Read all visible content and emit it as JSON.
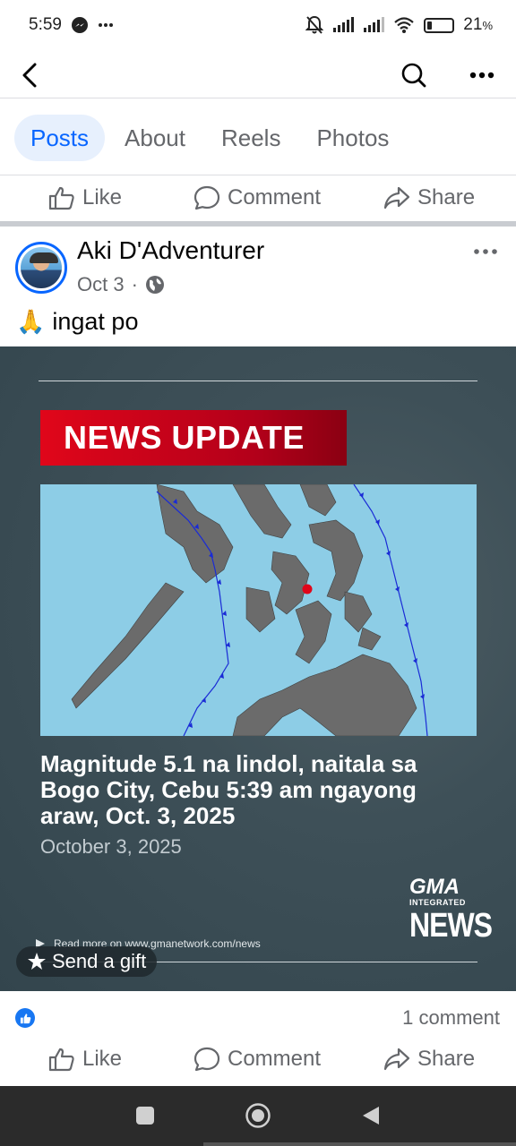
{
  "status_bar": {
    "time": "5:59",
    "battery_pct": "21",
    "battery_unit": "%",
    "battery_level": 0.21
  },
  "top_nav": {
    "back_icon": "back-arrow-icon",
    "search_icon": "search-icon",
    "more_icon": "more-dots-icon"
  },
  "tabs": [
    {
      "label": "Posts",
      "active": true
    },
    {
      "label": "About",
      "active": false
    },
    {
      "label": "Reels",
      "active": false
    },
    {
      "label": "Photos",
      "active": false
    }
  ],
  "top_actions": {
    "like": "Like",
    "comment": "Comment",
    "share": "Share"
  },
  "post": {
    "author": "Aki D'Adventurer",
    "date": "Oct 3",
    "separator": "·",
    "privacy_icon": "globe-icon",
    "text": "ingat po",
    "emoji": "🙏",
    "image": {
      "banner": "NEWS UPDATE",
      "headline": "Magnitude 5.1 na lindol, naitala sa Bogo City, Cebu 5:39 am ngayong araw, Oct. 3, 2025",
      "date": "October 3, 2025",
      "logo_top": "GMA",
      "logo_mid": "INTEGRATED",
      "logo_bottom": "NEWS",
      "read_more": "Read more on www.gmanetwork.com/news"
    },
    "send_gift": "Send a gift",
    "comment_count": "1 comment",
    "actions": {
      "like": "Like",
      "comment": "Comment",
      "share": "Share"
    }
  },
  "colors": {
    "accent": "#0866ff",
    "banner_red": "#e0061a",
    "map_sea": "#8dcde6",
    "image_bg": "#3e5058"
  }
}
